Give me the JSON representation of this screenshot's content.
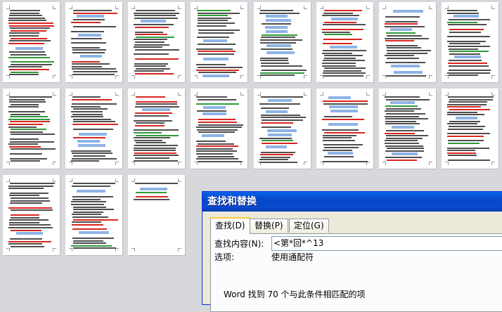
{
  "dialog": {
    "title": "查找和替换",
    "tabs": [
      {
        "label": "查找(D)",
        "active": true
      },
      {
        "label": "替换(P)",
        "active": false
      },
      {
        "label": "定位(G)",
        "active": false
      }
    ],
    "find_label": "查找内容(N):",
    "find_value": "<第*回*^13",
    "options_label": "选项:",
    "options_value": "使用通配符",
    "status_text": "Word 找到 70 个与此条件相匹配的项"
  },
  "colors": {
    "highlight": "#8eb4e6",
    "red_text": "#d8261e",
    "green_text": "#2e9a3a",
    "titlebar": "#0747c9"
  }
}
